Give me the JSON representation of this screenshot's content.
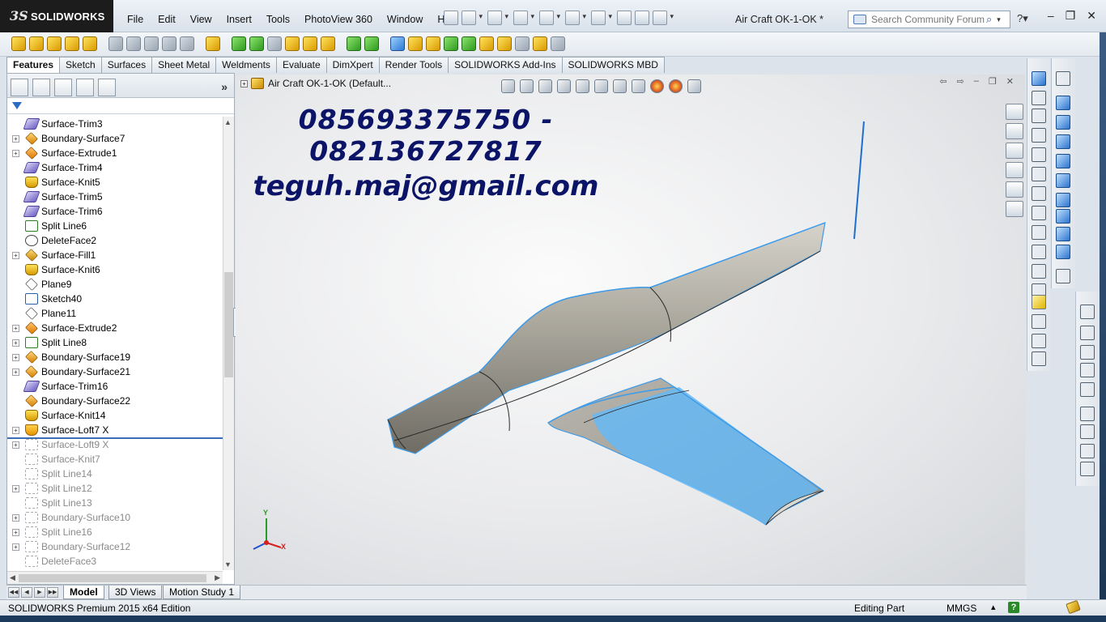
{
  "app": {
    "logo_ds": "3S",
    "logo_text": "SOLIDWORKS",
    "document_title": "Air Craft OK-1-OK *"
  },
  "menu": [
    "File",
    "Edit",
    "View",
    "Insert",
    "Tools",
    "PhotoView 360",
    "Window",
    "Help"
  ],
  "search": {
    "placeholder": "Search Community Forum"
  },
  "command_tabs": [
    {
      "label": "Features",
      "active": true
    },
    {
      "label": "Sketch"
    },
    {
      "label": "Surfaces"
    },
    {
      "label": "Sheet Metal"
    },
    {
      "label": "Weldments"
    },
    {
      "label": "Evaluate"
    },
    {
      "label": "DimXpert"
    },
    {
      "label": "Render Tools"
    },
    {
      "label": "SOLIDWORKS Add-Ins"
    },
    {
      "label": "SOLIDWORKS MBD"
    }
  ],
  "feature_tree": {
    "items": [
      {
        "label": "Surface-Trim3",
        "icon": "surface-trim-icon",
        "expandable": false,
        "suppressed": false
      },
      {
        "label": "Boundary-Surface7",
        "icon": "boundary-surface-icon",
        "expandable": true,
        "suppressed": false
      },
      {
        "label": "Surface-Extrude1",
        "icon": "surface-extrude-icon",
        "expandable": true,
        "suppressed": false
      },
      {
        "label": "Surface-Trim4",
        "icon": "surface-trim-icon",
        "expandable": false,
        "suppressed": false
      },
      {
        "label": "Surface-Knit5",
        "icon": "surface-knit-icon",
        "expandable": false,
        "suppressed": false
      },
      {
        "label": "Surface-Trim5",
        "icon": "surface-trim-icon",
        "expandable": false,
        "suppressed": false
      },
      {
        "label": "Surface-Trim6",
        "icon": "surface-trim-icon",
        "expandable": false,
        "suppressed": false
      },
      {
        "label": "Split Line6",
        "icon": "split-line-icon",
        "expandable": false,
        "suppressed": false
      },
      {
        "label": "DeleteFace2",
        "icon": "delete-face-icon",
        "expandable": false,
        "suppressed": false
      },
      {
        "label": "Surface-Fill1",
        "icon": "surface-fill-icon",
        "expandable": true,
        "suppressed": false
      },
      {
        "label": "Surface-Knit6",
        "icon": "surface-knit-icon",
        "expandable": false,
        "suppressed": false
      },
      {
        "label": "Plane9",
        "icon": "plane-icon",
        "expandable": false,
        "suppressed": false
      },
      {
        "label": "Sketch40",
        "icon": "sketch-icon",
        "expandable": false,
        "suppressed": false
      },
      {
        "label": "Plane11",
        "icon": "plane-icon",
        "expandable": false,
        "suppressed": false
      },
      {
        "label": "Surface-Extrude2",
        "icon": "surface-extrude-icon",
        "expandable": true,
        "suppressed": false
      },
      {
        "label": "Split Line8",
        "icon": "split-line-icon",
        "expandable": true,
        "suppressed": false
      },
      {
        "label": "Boundary-Surface19",
        "icon": "boundary-surface-icon",
        "expandable": true,
        "suppressed": false
      },
      {
        "label": "Boundary-Surface21",
        "icon": "boundary-surface-icon",
        "expandable": true,
        "suppressed": false
      },
      {
        "label": "Surface-Trim16",
        "icon": "surface-trim-icon",
        "expandable": false,
        "suppressed": false
      },
      {
        "label": "Boundary-Surface22",
        "icon": "boundary-surface-icon",
        "expandable": false,
        "suppressed": false
      },
      {
        "label": "Surface-Knit14",
        "icon": "surface-knit-icon",
        "expandable": false,
        "suppressed": false
      },
      {
        "label": "Surface-Loft7 X",
        "icon": "surface-loft-icon",
        "expandable": true,
        "suppressed": false
      },
      {
        "label": "Surface-Loft9 X",
        "icon": "surface-loft-icon",
        "expandable": true,
        "suppressed": true
      },
      {
        "label": "Surface-Knit7",
        "icon": "surface-knit-icon",
        "expandable": false,
        "suppressed": true
      },
      {
        "label": "Split Line14",
        "icon": "split-line-icon",
        "expandable": false,
        "suppressed": true
      },
      {
        "label": "Split Line12",
        "icon": "split-line-icon",
        "expandable": true,
        "suppressed": true
      },
      {
        "label": "Split Line13",
        "icon": "split-line-icon",
        "expandable": false,
        "suppressed": true
      },
      {
        "label": "Boundary-Surface10",
        "icon": "boundary-surface-icon",
        "expandable": true,
        "suppressed": true
      },
      {
        "label": "Split Line16",
        "icon": "split-line-icon",
        "expandable": true,
        "suppressed": true
      },
      {
        "label": "Boundary-Surface12",
        "icon": "boundary-surface-icon",
        "expandable": true,
        "suppressed": true
      },
      {
        "label": "DeleteFace3",
        "icon": "delete-face-icon",
        "expandable": false,
        "suppressed": true
      }
    ]
  },
  "graphics": {
    "tree_label": "Air Craft OK-1-OK  (Default...",
    "watermark_line1": "085693375750 -",
    "watermark_line2": "082136727817",
    "watermark_line3": "teguh.maj@gmail.com",
    "triad_x": "X",
    "triad_y": "Y",
    "body_color": "#a9a69c",
    "highlight_color": "#3d9be9",
    "wing_color": "#66b8f5"
  },
  "bottom_tabs": [
    {
      "label": "Model",
      "active": true
    },
    {
      "label": "3D Views"
    },
    {
      "label": "Motion Study 1"
    }
  ],
  "status": {
    "edition": "SOLIDWORKS Premium 2015 x64 Edition",
    "mode": "Editing Part",
    "units": "MMGS",
    "units_arrow": "▴",
    "help": "?"
  }
}
